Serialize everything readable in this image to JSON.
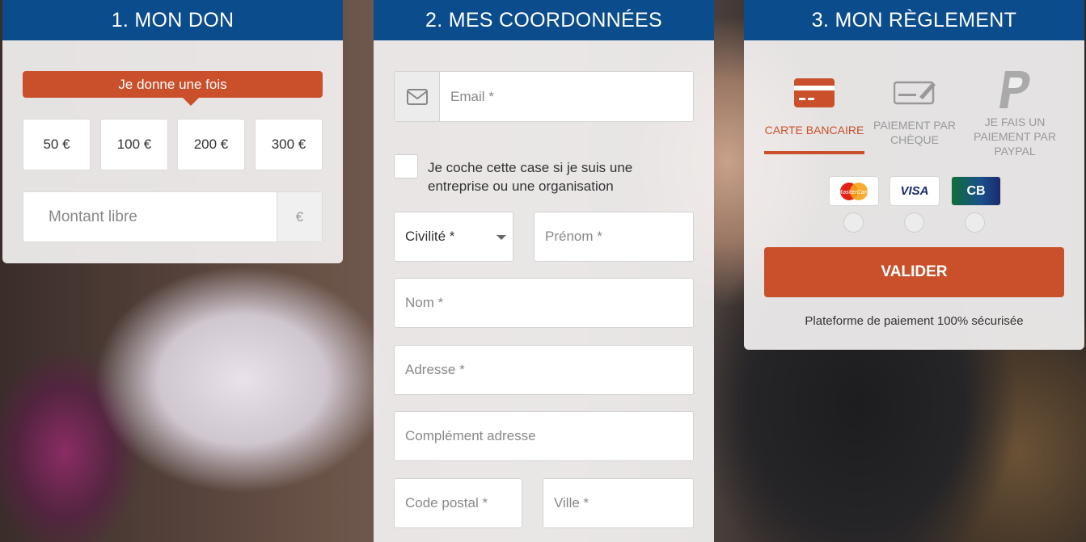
{
  "step1": {
    "title": "1. MON DON",
    "frequency_tab": "Je donne une fois",
    "amounts": [
      "50 €",
      "100 €",
      "200 €",
      "300 €"
    ],
    "free_amount_placeholder": "Montant libre",
    "currency_symbol": "€"
  },
  "step2": {
    "title": "2. MES COORDONNÉES",
    "email_placeholder": "Email *",
    "company_checkbox_label": "Je coche cette case si je suis une entreprise ou une organisation",
    "civility_select": "Civilité *",
    "firstname_placeholder": "Prénom *",
    "lastname_placeholder": "Nom *",
    "address_placeholder": "Adresse *",
    "address_complement_placeholder": "Complément adresse",
    "postal_code_placeholder": "Code postal *",
    "city_placeholder": "Ville *"
  },
  "step3": {
    "title": "3. MON RÈGLEMENT",
    "methods": [
      {
        "label": "CARTE BANCAIRE",
        "icon": "credit-card-icon",
        "active": true
      },
      {
        "label": "PAIEMENT PAR CHÈQUE",
        "icon": "cheque-icon",
        "active": false
      },
      {
        "label": "JE FAIS UN PAIEMENT PAR PAYPAL",
        "icon": "paypal-icon",
        "active": false
      }
    ],
    "card_brands": [
      "MasterCard",
      "VISA",
      "CB"
    ],
    "submit_label": "VALIDER",
    "secure_note": "Plateforme de paiement 100% sécurisée"
  },
  "colors": {
    "header_blue": "#0b4d8c",
    "accent_orange": "#c9502b",
    "panel_bg": "#f2f0f0"
  }
}
